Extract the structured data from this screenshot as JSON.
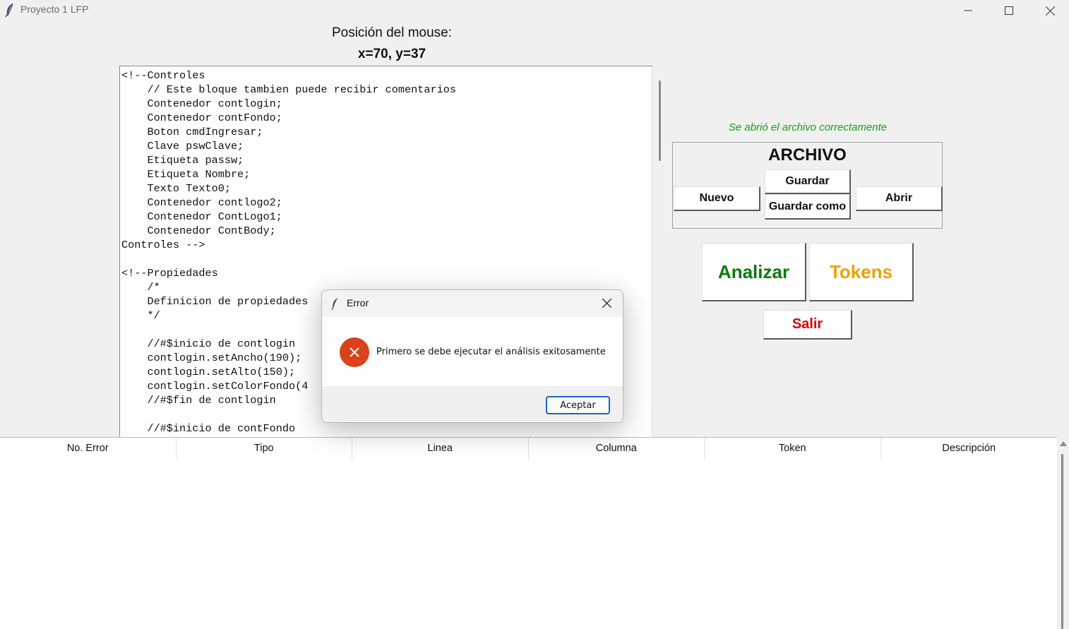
{
  "window": {
    "title": "Proyecto 1 LFP",
    "icon": "feather-icon",
    "controls": [
      "minimize-icon",
      "maximize-icon",
      "close-icon"
    ]
  },
  "mouse": {
    "label": "Posición del mouse:",
    "coords": "x=70, y=37"
  },
  "editor": {
    "lines": [
      "<!--Controles",
      "    // Este bloque tambien puede recibir comentarios",
      "    Contenedor contlogin;",
      "    Contenedor contFondo;",
      "    Boton cmdIngresar;",
      "    Clave pswClave;",
      "    Etiqueta passw;",
      "    Etiqueta Nombre;",
      "    Texto Texto0;",
      "    Contenedor contlogo2;",
      "    Contenedor ContLogo1;",
      "    Contenedor ContBody;",
      "Controles -->",
      "",
      "<!--Propiedades",
      "    /*",
      "    Definicion de propiedades",
      "    */",
      "",
      "    //#$inicio de contlogin",
      "    contlogin.setAncho(190);",
      "    contlogin.setAlto(150);",
      "    contlogin.setColorFondo(4",
      "    //#$fin de contlogin",
      "",
      "    //#$inicio de contFondo"
    ]
  },
  "status": {
    "message": "Se abrió el archivo correctamente",
    "color": "#1b9e1b"
  },
  "archivo": {
    "title": "ARCHIVO",
    "nuevo": "Nuevo",
    "guardar": "Guardar",
    "guardar_como": "Guardar como",
    "abrir": "Abrir"
  },
  "actions": {
    "analizar": "Analizar",
    "analizar_color": "#0a7a0a",
    "tokens": "Tokens",
    "tokens_color": "#f0a000",
    "salir": "Salir",
    "salir_color": "#e00000"
  },
  "table": {
    "columns": [
      "No. Error",
      "Tipo",
      "Linea",
      "Columna",
      "Token",
      "Descripción"
    ],
    "rows": []
  },
  "dialog": {
    "title": "Error",
    "icon": "error-icon",
    "message": "Primero se debe ejecutar el análisis exitosamente",
    "ok_label": "Aceptar"
  }
}
